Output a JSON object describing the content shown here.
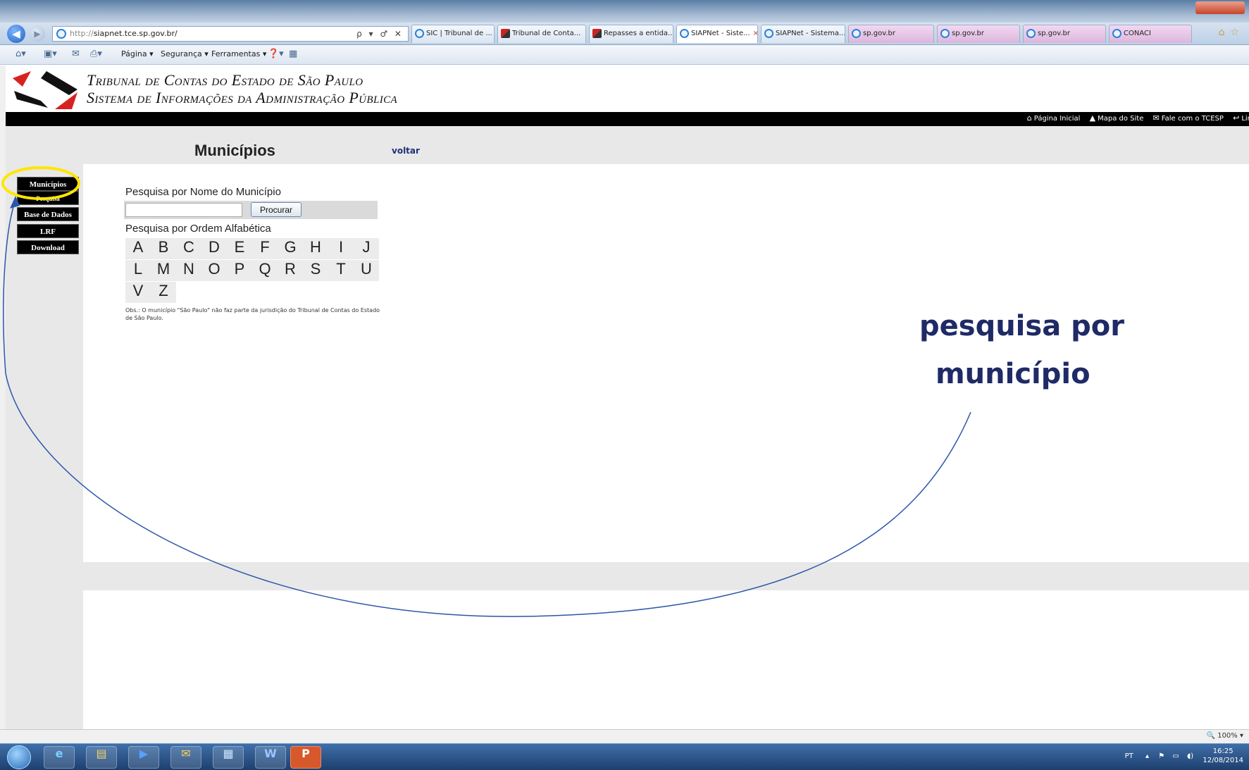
{
  "browser": {
    "address": {
      "protocol": "http://",
      "host": "siapnet.tce.sp.gov.br/",
      "tools": "ρ ▾ ♂ ✕"
    },
    "tabs": [
      {
        "label": "SIC | Tribunal de ...",
        "icon": "ie-icon"
      },
      {
        "label": "Tribunal de Conta...",
        "icon": "tce-icon"
      },
      {
        "label": "Repasses a entida...",
        "icon": "tce-icon"
      },
      {
        "label": "SIAPNet - Siste...",
        "icon": "ie-icon",
        "active": true
      },
      {
        "label": "SIAPNet - Sistema...",
        "icon": "ie-icon"
      },
      {
        "label": "sp.gov.br",
        "icon": "ie-icon"
      },
      {
        "label": "sp.gov.br",
        "icon": "ie-icon"
      },
      {
        "label": "sp.gov.br",
        "icon": "ie-icon"
      },
      {
        "label": "CONACI",
        "icon": "ie-icon"
      }
    ],
    "commands": {
      "pagina": "Página ▾",
      "seguranca": "Segurança ▾",
      "ferramentas": "Ferramentas ▾"
    },
    "zoom": "🔍 100%  ▾"
  },
  "site": {
    "brand_line1": "Tribunal de Contas do Estado de São Paulo",
    "brand_line2": "Sistema de Informações da Administração Pública",
    "top_links": [
      "Página Inicial",
      "Mapa do Site",
      "Fale com o TCESP",
      "Lin"
    ]
  },
  "sidebar": {
    "items": [
      "Municípios",
      "Pesquisa",
      "Base de Dados",
      "LRF",
      "Download"
    ]
  },
  "main": {
    "title": "Municípios",
    "back_link": "voltar",
    "search_label": "Pesquisa por Nome do Município",
    "search_value": "",
    "search_button": "Procurar",
    "alpha_label": "Pesquisa por Ordem Alfabética",
    "letters": [
      "A",
      "B",
      "C",
      "D",
      "E",
      "F",
      "G",
      "H",
      "I",
      "J",
      "L",
      "M",
      "N",
      "O",
      "P",
      "Q",
      "R",
      "S",
      "T",
      "U",
      "V",
      "Z"
    ],
    "note": "Obs.: O município \"São Paulo\" não faz parte da jurisdição do Tribunal de Contas do Estado de São Paulo."
  },
  "annotation": {
    "line1": "pesquisa por",
    "line2": "município",
    "text_color": "#1f2a66",
    "highlight_color": "#ffe600",
    "arrow_color": "#2b56a8"
  },
  "taskbar": {
    "language": "PT",
    "time": "16:25",
    "date": "12/08/2014"
  }
}
